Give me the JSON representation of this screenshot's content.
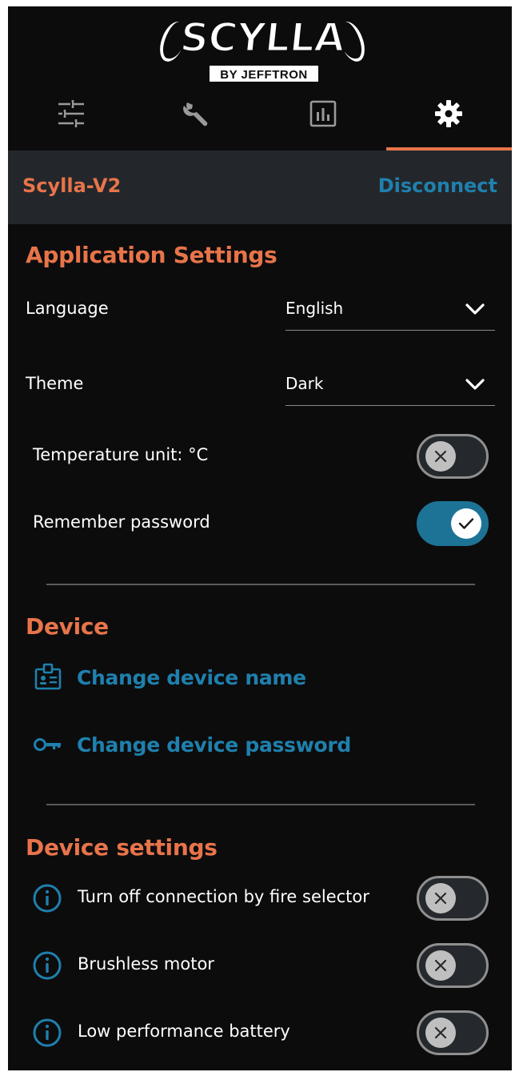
{
  "logo": {
    "main": "SCYLLA",
    "sub": "BY JEFFTRON"
  },
  "tabs": [
    {
      "icon": "sliders-icon"
    },
    {
      "icon": "wrench-icon"
    },
    {
      "icon": "chart-icon"
    },
    {
      "icon": "gear-icon",
      "active": true
    }
  ],
  "device_bar": {
    "name": "Scylla-V2",
    "action": "Disconnect"
  },
  "application_settings": {
    "title": "Application Settings",
    "language": {
      "label": "Language",
      "value": "English"
    },
    "theme": {
      "label": "Theme",
      "value": "Dark"
    },
    "temperature": {
      "label": "Temperature unit:  °C",
      "on": false
    },
    "remember_password": {
      "label": "Remember password",
      "on": true
    }
  },
  "device": {
    "title": "Device",
    "change_name": "Change device name",
    "change_password": "Change device password"
  },
  "device_settings": {
    "title": "Device settings",
    "items": [
      {
        "label": "Turn off connection by fire selector",
        "on": false
      },
      {
        "label": "Brushless motor",
        "on": false
      },
      {
        "label": "Low performance battery",
        "on": false
      }
    ]
  },
  "colors": {
    "accent_orange": "#e8744a",
    "accent_blue": "#1f80ad",
    "background": "#0c0c0d",
    "device_bar": "#23272b"
  }
}
